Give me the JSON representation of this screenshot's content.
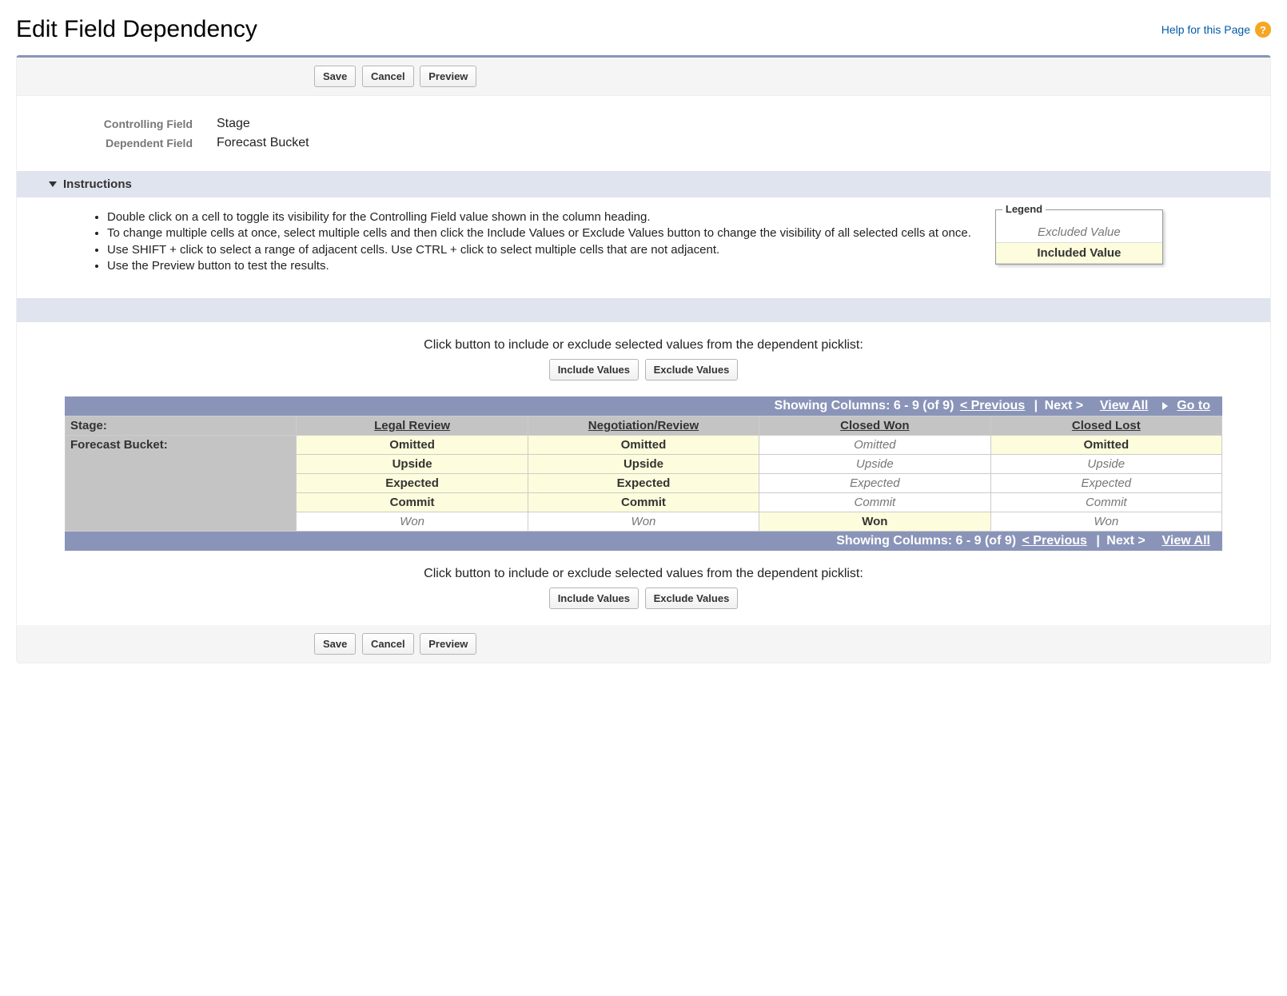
{
  "header": {
    "title": "Edit Field Dependency",
    "help_label": "Help for this Page"
  },
  "buttons": {
    "save": "Save",
    "cancel": "Cancel",
    "preview": "Preview",
    "include": "Include Values",
    "exclude": "Exclude Values"
  },
  "fields": {
    "controlling_label": "Controlling Field",
    "controlling_value": "Stage",
    "dependent_label": "Dependent Field",
    "dependent_value": "Forecast Bucket"
  },
  "instructions": {
    "heading": "Instructions",
    "items": [
      "Double click on a cell to toggle its visibility for the Controlling Field value shown in the column heading.",
      "To change multiple cells at once, select multiple cells and then click the Include Values or Exclude Values button to change the visibility of all selected cells at once.",
      "Use SHIFT + click to select a range of adjacent cells. Use CTRL + click to select multiple cells that are not adjacent.",
      "Use the Preview button to test the results."
    ]
  },
  "legend": {
    "title": "Legend",
    "excluded": "Excluded Value",
    "included": "Included Value"
  },
  "mid_text": "Click button to include or exclude selected values from the dependent picklist:",
  "nav": {
    "showing_top": "Showing Columns: 6 - 9 (of 9) ",
    "prev": "< Previous",
    "next": "Next >",
    "view_all": "View All",
    "go_to": "Go to",
    "showing_bottom": "Showing Columns: 6 - 9 (of 9) "
  },
  "grid": {
    "stage_label": "Stage:",
    "bucket_label": "Forecast Bucket:",
    "columns": [
      "Legal Review",
      "Negotiation/Review",
      "Closed Won",
      "Closed Lost"
    ],
    "rows": [
      {
        "value": "Omitted",
        "states": [
          "incl",
          "incl",
          "excl",
          "incl"
        ]
      },
      {
        "value": "Upside",
        "states": [
          "incl",
          "incl",
          "excl",
          "excl"
        ]
      },
      {
        "value": "Expected",
        "states": [
          "incl",
          "incl",
          "excl",
          "excl"
        ]
      },
      {
        "value": "Commit",
        "states": [
          "incl",
          "incl",
          "excl",
          "excl"
        ]
      },
      {
        "value": "Won",
        "states": [
          "excl",
          "excl",
          "incl",
          "excl"
        ]
      }
    ]
  }
}
